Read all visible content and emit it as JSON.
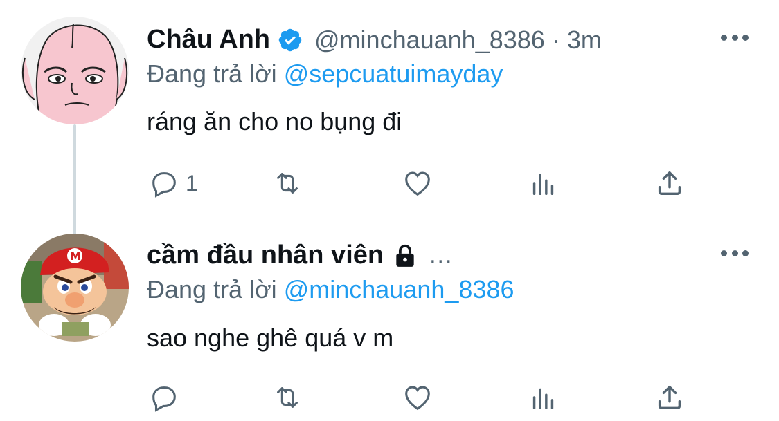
{
  "tweets": [
    {
      "name": "Châu Anh",
      "verified": true,
      "handle": "@minchauanh_8386",
      "separator": "·",
      "time": "3m",
      "replying_prefix": "Đang trả lời",
      "replying_to": "@sepcuatuimayday",
      "text": "ráng ăn cho no bụng đi",
      "reply_count": "1",
      "avatar_icon": "pink-cartoon-face-avatar"
    },
    {
      "name": "cầm đầu nhân viên",
      "locked": true,
      "truncation": "...",
      "replying_prefix": "Đang trả lời",
      "replying_to": "@minchauanh_8386",
      "text": "sao nghe ghê quá v m",
      "reply_count": "",
      "avatar_icon": "mario-avatar"
    }
  ],
  "icons": {
    "reply": "reply-icon",
    "retweet": "retweet-icon",
    "like": "heart-icon",
    "views": "views-icon",
    "share": "share-icon",
    "more": "more-icon"
  },
  "colors": {
    "text": "#0f1419",
    "secondary": "#536471",
    "accent": "#1d9bf0",
    "thread_line": "#cfd9de"
  }
}
